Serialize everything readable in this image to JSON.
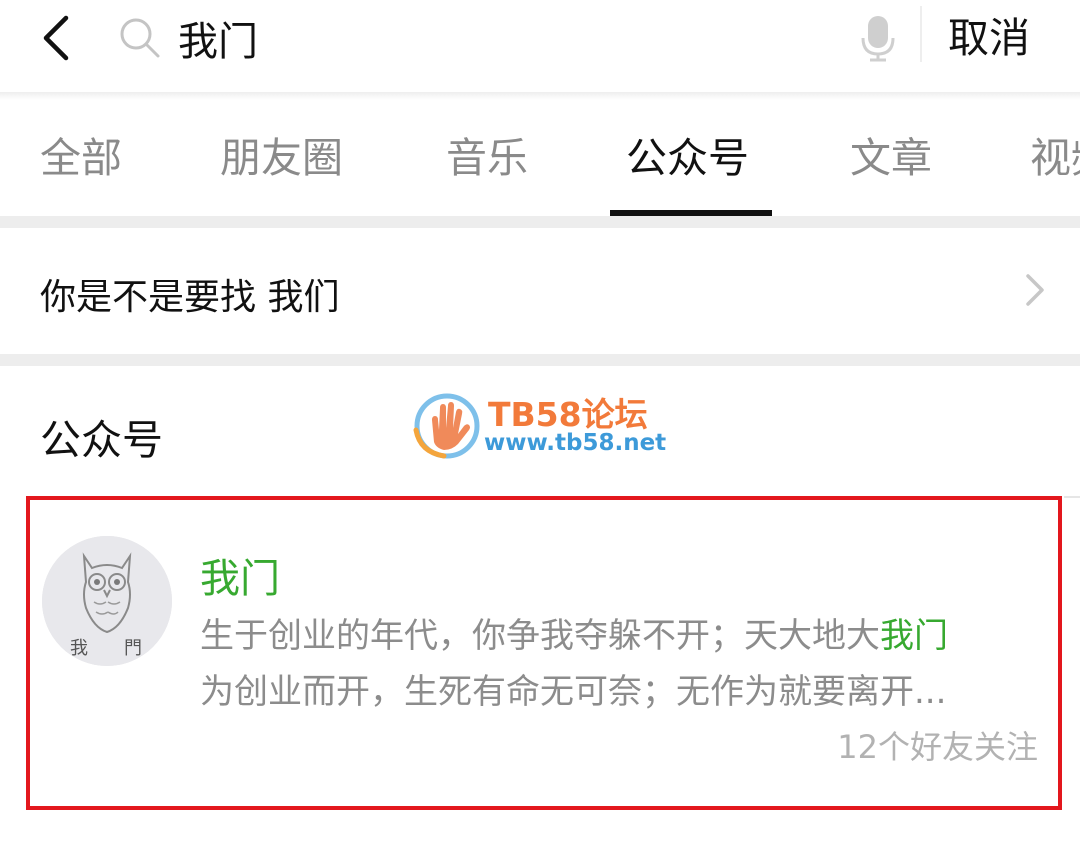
{
  "search": {
    "query": "我门",
    "cancel_label": "取消"
  },
  "tabs": [
    {
      "label": "全部"
    },
    {
      "label": "朋友圈"
    },
    {
      "label": "音乐"
    },
    {
      "label": "公众号",
      "active": true
    },
    {
      "label": "文章"
    },
    {
      "label": "视频"
    }
  ],
  "suggestion": {
    "label": "你是不是要找 我们"
  },
  "section": {
    "title": "公众号"
  },
  "watermark": {
    "title": "TB58论坛",
    "url": "www.tb58.net"
  },
  "result": {
    "name": "我门",
    "desc_part1": "生于创业的年代，你争我夺躲不开；天大地大",
    "desc_highlight": "我门",
    "desc_line2": "为创业而开，生死有命无可奈；无作为就要离开...",
    "follow_text": "12个好友关注",
    "avatar_text": [
      "我",
      "門"
    ]
  },
  "colors": {
    "accent_green": "#37a930",
    "highlight_border": "#e3171d",
    "watermark_orange": "#f27a3a",
    "watermark_blue": "#3d9ad9"
  },
  "icons": [
    "back-icon",
    "search-icon",
    "microphone-icon",
    "chevron-right-icon",
    "owl-icon"
  ]
}
